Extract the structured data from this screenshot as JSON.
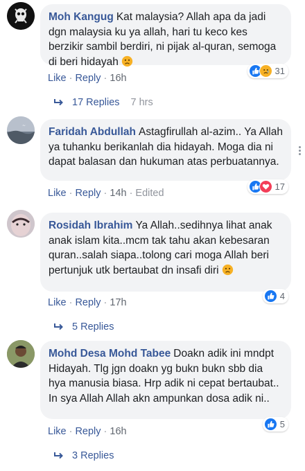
{
  "actions": {
    "like": "Like",
    "reply": "Reply"
  },
  "comments": [
    {
      "author": "Moh Kangug",
      "text": "Kat malaysia? Allah apa da jadi dgn malaysia ku ya allah, hari tu keco kes berzikir sambil berdiri, ni pijak al-quran, semoga di beri hidayah",
      "time": "16h",
      "edited": "",
      "reactions": [
        "like",
        "sad"
      ],
      "reaction_count": "31",
      "replies_label": "17 Replies",
      "replies_ago": "7 hrs"
    },
    {
      "author": "Faridah Abdullah",
      "text": "Astagfirullah al-azim.. Ya Allah ya tuhanku berikanlah dia hidayah. Moga dia ni dapat balasan dan hukuman atas perbuatannya.",
      "time": "14h",
      "edited": "Edited",
      "reactions": [
        "like",
        "love"
      ],
      "reaction_count": "17",
      "replies_label": "",
      "replies_ago": ""
    },
    {
      "author": "Rosidah Ibrahim",
      "text": "Ya Allah..sedihnya lihat anak anak islam kita..mcm tak tahu akan kebesaran quran..salah siapa..tolong cari moga Allah beri pertunjuk utk bertaubat dn insafi diri",
      "time": "17h",
      "edited": "",
      "reactions": [
        "like"
      ],
      "reaction_count": "4",
      "replies_label": "5 Replies",
      "replies_ago": ""
    },
    {
      "author": "Mohd Desa Mohd Tabee",
      "text": "Doakn adik ini mndpt Hidayah. Tlg jgn doakn yg bukn bukn sbb dia hya manusia biasa. Hrp adik ni cepat bertaubat.. In sya Allah Allah akn ampunkan dosa adik ni..",
      "time": "16h",
      "edited": "",
      "reactions": [
        "like"
      ],
      "reaction_count": "5",
      "replies_label": "3 Replies",
      "replies_ago": ""
    }
  ]
}
